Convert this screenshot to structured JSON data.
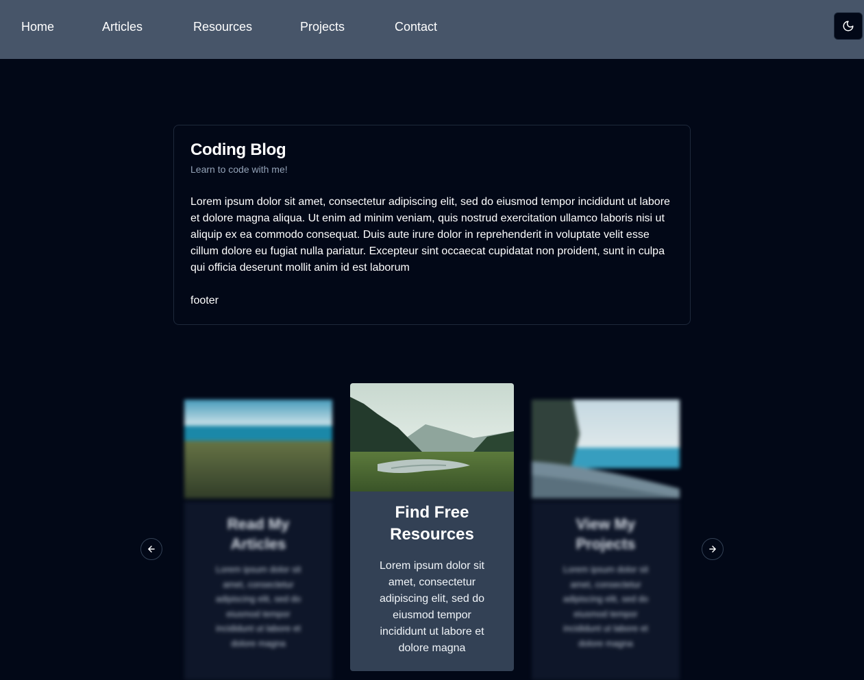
{
  "nav": {
    "links": [
      "Home",
      "Articles",
      "Resources",
      "Projects",
      "Contact"
    ],
    "theme_toggle_icon": "moon-icon"
  },
  "blog": {
    "title": "Coding Blog",
    "subtitle": "Learn to code with me!",
    "body": "Lorem ipsum dolor sit amet, consectetur adipiscing elit, sed do eiusmod tempor incididunt ut labore et dolore magna aliqua. Ut enim ad minim veniam, quis nostrud exercitation ullamco laboris nisi ut aliquip ex ea commodo consequat. Duis aute irure dolor in reprehenderit in voluptate velit esse cillum dolore eu fugiat nulla pariatur. Excepteur sint occaecat cupidatat non proident, sunt in culpa qui officia deserunt mollit anim id est laborum",
    "footer": "footer"
  },
  "carousel": {
    "prev_icon": "arrow-left-icon",
    "next_icon": "arrow-right-icon",
    "cards": [
      {
        "title": "Read My Articles",
        "text": "Lorem ipsum dolor sit amet, consectetur adipiscing elit, sed do eiusmod tempor incididunt ut labore et dolore magna",
        "image": "lake-grass-image"
      },
      {
        "title": "Find Free Resources",
        "text": "Lorem ipsum dolor sit amet, consectetur adipiscing elit, sed do eiusmod tempor incididunt ut labore et dolore magna",
        "image": "forest-valley-river-image"
      },
      {
        "title": "View My Projects",
        "text": "Lorem ipsum dolor sit amet, consectetur adipiscing elit, sed do eiusmod tempor incididunt ut labore et dolore magna",
        "image": "coastline-image"
      }
    ]
  },
  "colors": {
    "background": "#020817",
    "nav": "#475569",
    "center_card": "#334155",
    "muted_text": "#94a3b8"
  }
}
